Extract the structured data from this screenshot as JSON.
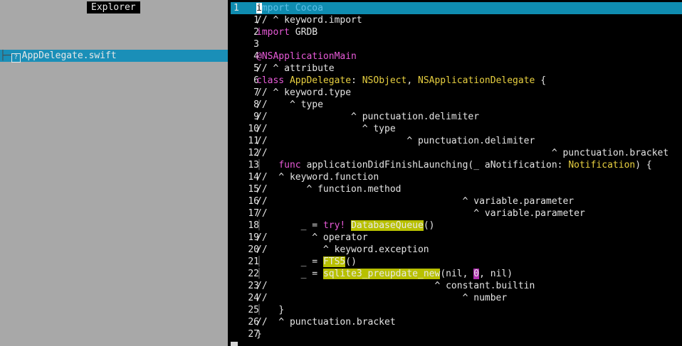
{
  "explorer": {
    "title": "Explorer",
    "tree_prefix": "├─",
    "file_icon": "?",
    "file_name": "AppDelegate.swift"
  },
  "editor": {
    "current_line_number": "1",
    "lines": [
      {
        "n": "",
        "segs": [
          {
            "t": "i",
            "c": "cursor"
          },
          {
            "t": "mport Cocoa",
            "c": "cur-rest"
          }
        ]
      },
      {
        "n": "1",
        "segs": [
          {
            "t": "// ^ keyword.import",
            "c": "cm"
          }
        ]
      },
      {
        "n": "2",
        "segs": [
          {
            "t": "import",
            "c": "kw"
          },
          {
            "t": " GRDB",
            "c": ""
          }
        ]
      },
      {
        "n": "3",
        "segs": []
      },
      {
        "n": "4",
        "segs": [
          {
            "t": "@NSApplicationMain",
            "c": "kw"
          }
        ]
      },
      {
        "n": "5",
        "segs": [
          {
            "t": "// ^ attribute",
            "c": "cm"
          }
        ]
      },
      {
        "n": "6",
        "segs": [
          {
            "t": "class",
            "c": "kw"
          },
          {
            "t": " ",
            "c": ""
          },
          {
            "t": "AppDelegate",
            "c": "ty"
          },
          {
            "t": ": ",
            "c": ""
          },
          {
            "t": "NSObject",
            "c": "ty"
          },
          {
            "t": ", ",
            "c": ""
          },
          {
            "t": "NSApplicationDelegate",
            "c": "ty"
          },
          {
            "t": " {",
            "c": ""
          }
        ]
      },
      {
        "n": "7",
        "segs": [
          {
            "t": "// ^ keyword.type",
            "c": "cm"
          }
        ]
      },
      {
        "n": "8",
        "segs": [
          {
            "t": "//    ^ type",
            "c": "cm"
          }
        ]
      },
      {
        "n": "9",
        "segs": [
          {
            "t": "//               ^ punctuation.delimiter",
            "c": "cm"
          }
        ]
      },
      {
        "n": "10",
        "segs": [
          {
            "t": "//                 ^ type",
            "c": "cm"
          }
        ]
      },
      {
        "n": "11",
        "segs": [
          {
            "t": "//                         ^ punctuation.delimiter",
            "c": "cm"
          }
        ]
      },
      {
        "n": "12",
        "segs": [
          {
            "t": "//                                                   ^ punctuation.bracket",
            "c": "cm"
          }
        ]
      },
      {
        "n": "13",
        "segs": [
          {
            "t": "│   ",
            "c": "guide"
          },
          {
            "t": "func",
            "c": "kw"
          },
          {
            "t": " applicationDidFinishLaunching(_ aNotification: ",
            "c": ""
          },
          {
            "t": "Notification",
            "c": "ty"
          },
          {
            "t": ") {",
            "c": ""
          }
        ]
      },
      {
        "n": "14",
        "segs": [
          {
            "t": "//  ^ keyword.function",
            "c": "cm"
          }
        ]
      },
      {
        "n": "15",
        "segs": [
          {
            "t": "//       ^ function.method",
            "c": "cm"
          }
        ]
      },
      {
        "n": "16",
        "segs": [
          {
            "t": "//                                   ^ variable.parameter",
            "c": "cm"
          }
        ]
      },
      {
        "n": "17",
        "segs": [
          {
            "t": "//                                     ^ variable.parameter",
            "c": "cm"
          }
        ]
      },
      {
        "n": "18",
        "segs": [
          {
            "t": "│       ",
            "c": "guide"
          },
          {
            "t": "_ = ",
            "c": ""
          },
          {
            "t": "try!",
            "c": "kw"
          },
          {
            "t": " ",
            "c": ""
          },
          {
            "t": "DatabaseQueue",
            "c": "hl"
          },
          {
            "t": "()",
            "c": ""
          }
        ]
      },
      {
        "n": "19",
        "segs": [
          {
            "t": "//        ^ operator",
            "c": "cm"
          }
        ]
      },
      {
        "n": "20",
        "segs": [
          {
            "t": "//          ^ keyword.exception",
            "c": "cm"
          }
        ]
      },
      {
        "n": "21",
        "segs": [
          {
            "t": "│       ",
            "c": "guide"
          },
          {
            "t": "_ = ",
            "c": ""
          },
          {
            "t": "FTS5",
            "c": "hl"
          },
          {
            "t": "()",
            "c": ""
          }
        ]
      },
      {
        "n": "22",
        "segs": [
          {
            "t": "│       ",
            "c": "guide"
          },
          {
            "t": "_ = ",
            "c": ""
          },
          {
            "t": "sqlite3_preupdate_new",
            "c": "hl"
          },
          {
            "t": "(nil, ",
            "c": ""
          },
          {
            "t": "0",
            "c": "numhl"
          },
          {
            "t": ", nil)",
            "c": ""
          }
        ]
      },
      {
        "n": "23",
        "segs": [
          {
            "t": "//                              ^ constant.builtin",
            "c": "cm"
          }
        ]
      },
      {
        "n": "24",
        "segs": [
          {
            "t": "//                                   ^ number",
            "c": "cm"
          }
        ]
      },
      {
        "n": "25",
        "segs": [
          {
            "t": "│   ",
            "c": "guide"
          },
          {
            "t": "}",
            "c": ""
          }
        ]
      },
      {
        "n": "26",
        "segs": [
          {
            "t": "//  ^ punctuation.bracket",
            "c": "cm"
          }
        ]
      },
      {
        "n": "27",
        "segs": [
          {
            "t": "}",
            "c": ""
          }
        ]
      }
    ]
  }
}
